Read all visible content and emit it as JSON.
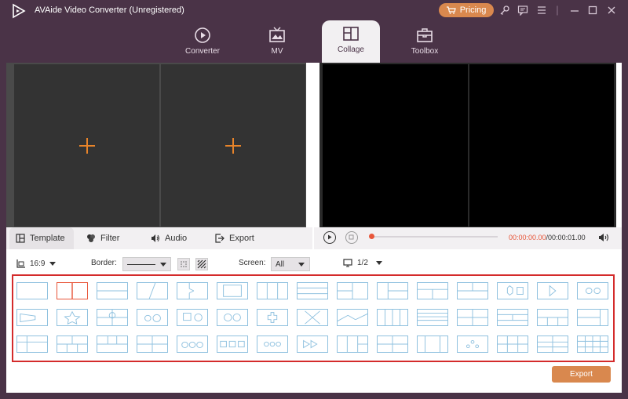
{
  "app": {
    "title": "AVAide Video Converter (Unregistered)"
  },
  "titlebar": {
    "pricing_label": "Pricing",
    "icons": [
      "key-icon",
      "chat-icon",
      "menu-icon",
      "minimize-icon",
      "maximize-icon",
      "close-icon"
    ]
  },
  "nav": {
    "tabs": [
      {
        "label": "Converter",
        "icon": "converter-icon"
      },
      {
        "label": "MV",
        "icon": "mv-icon"
      },
      {
        "label": "Collage",
        "icon": "collage-icon",
        "active": true
      },
      {
        "label": "Toolbox",
        "icon": "toolbox-icon"
      }
    ]
  },
  "editor": {
    "tabs": [
      {
        "label": "Template",
        "active": true
      },
      {
        "label": "Filter"
      },
      {
        "label": "Audio"
      },
      {
        "label": "Export"
      }
    ]
  },
  "player": {
    "current_time": "00:00:00.00",
    "total_time": "/00:00:01.00",
    "progress": 0
  },
  "options": {
    "ratio": "16:9",
    "border_label": "Border:",
    "screen_label": "Screen:",
    "screen_value": "All",
    "page_value": "1/2"
  },
  "export": {
    "label": "Export"
  },
  "colors": {
    "accent": "#d9884e",
    "highlight": "#e8563a",
    "frame": "#d42b2b",
    "template_line": "#8fc1df",
    "bg": "#4a3347"
  }
}
